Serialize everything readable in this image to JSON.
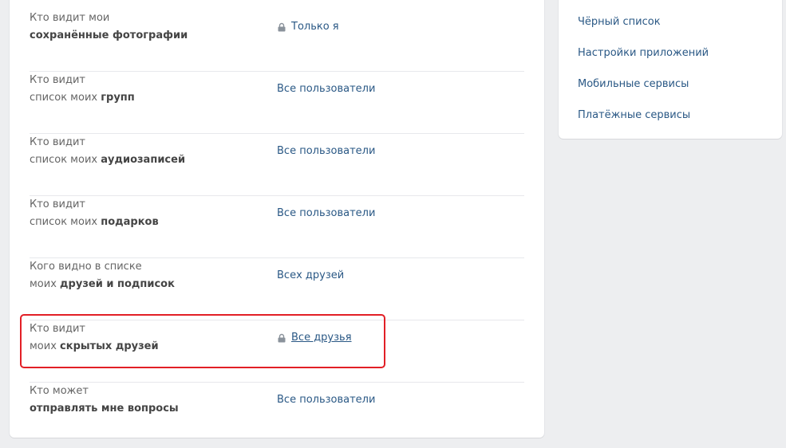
{
  "privacy_rows": [
    {
      "label_line1": "Кто видит мои",
      "label_line2_regular": "",
      "label_line2_bold": "сохранённые фотографии",
      "value": "Только я",
      "locked": true
    },
    {
      "label_line1": "Кто видит",
      "label_line2_regular": "список моих ",
      "label_line2_bold": "групп",
      "value": "Все пользователи",
      "locked": false
    },
    {
      "label_line1": "Кто видит",
      "label_line2_regular": "список моих ",
      "label_line2_bold": "аудиозаписей",
      "value": "Все пользователи",
      "locked": false
    },
    {
      "label_line1": "Кто видит",
      "label_line2_regular": "список моих ",
      "label_line2_bold": "подарков",
      "value": "Все пользователи",
      "locked": false
    },
    {
      "label_line1": "Кого видно в списке",
      "label_line2_regular": "моих ",
      "label_line2_bold": "друзей и подписок",
      "value": "Всех друзей",
      "locked": false
    },
    {
      "label_line1": "Кто видит",
      "label_line2_regular": "моих ",
      "label_line2_bold": "скрытых друзей",
      "value": "Все друзья",
      "locked": true
    },
    {
      "label_line1": "Кто может",
      "label_line2_regular": "",
      "label_line2_bold": "отправлять мне вопросы",
      "value": "Все пользователи",
      "locked": false
    }
  ],
  "sidebar": {
    "items": [
      {
        "label": "Чёрный список"
      },
      {
        "label": "Настройки приложений"
      },
      {
        "label": "Мобильные сервисы"
      },
      {
        "label": "Платёжные сервисы"
      }
    ]
  },
  "colors": {
    "background": "#edeef0",
    "link": "#2a5885",
    "highlight": "#e21f26",
    "label": "#656565"
  },
  "icons": {
    "lock": "lock-icon"
  }
}
